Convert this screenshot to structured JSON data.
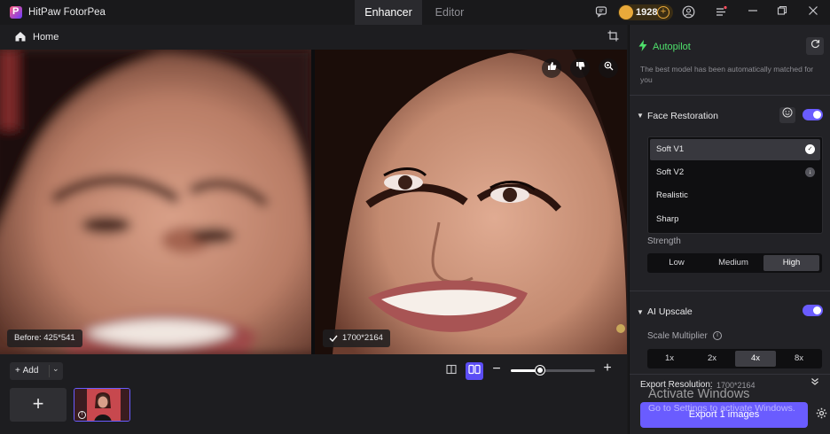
{
  "titlebar": {
    "app_name": "HitPaw FotorPea",
    "tabs": [
      {
        "label": "Enhancer",
        "active": true
      },
      {
        "label": "Editor",
        "active": false
      }
    ],
    "coins": "1928",
    "icons": [
      "chat-icon",
      "coin-icon",
      "add-coin-icon",
      "account-icon",
      "menu-icon",
      "minimize-icon",
      "restore-icon",
      "close-icon"
    ]
  },
  "toolbar": {
    "home_label": "Home"
  },
  "viewer": {
    "before_label": "Before: 425*541",
    "after_label": "1700*2164",
    "tools": [
      "thumbs-up-icon",
      "thumbs-down-icon",
      "zoom-icon"
    ]
  },
  "bottom": {
    "add_label": "Add",
    "add_tile_symbol": "+",
    "zoom_level_fraction": 0.35
  },
  "panel": {
    "autopilot": {
      "title": "Autopilot",
      "description": "The best model has been automatically matched for you"
    },
    "face_restoration": {
      "title": "Face Restoration",
      "enabled": true,
      "models": [
        {
          "label": "Soft V1",
          "selected": true,
          "status": "checked"
        },
        {
          "label": "Soft V2",
          "selected": false,
          "status": "download"
        },
        {
          "label": "Realistic",
          "selected": false,
          "status": ""
        },
        {
          "label": "Sharp",
          "selected": false,
          "status": ""
        }
      ],
      "strength_label": "Strength",
      "strength_options": [
        "Low",
        "Medium",
        "High"
      ],
      "strength_selected": "High"
    },
    "ai_upscale": {
      "title": "AI Upscale",
      "enabled": true,
      "scale_label": "Scale Multiplier",
      "scale_options": [
        "1x",
        "2x",
        "4x",
        "8x"
      ],
      "scale_selected": "4x"
    },
    "export": {
      "resolution_label": "Export Resolution:",
      "resolution_value": "1700*2164",
      "button_label": "Export 1 images"
    }
  },
  "watermark": {
    "title": "Activate Windows",
    "subtitle": "Go to Settings to activate Windows."
  },
  "colors": {
    "accent": "#6a5cff",
    "autopilot_green": "#4ee06b",
    "coin_gold": "#e9a93a",
    "panel_bg": "#222226"
  }
}
